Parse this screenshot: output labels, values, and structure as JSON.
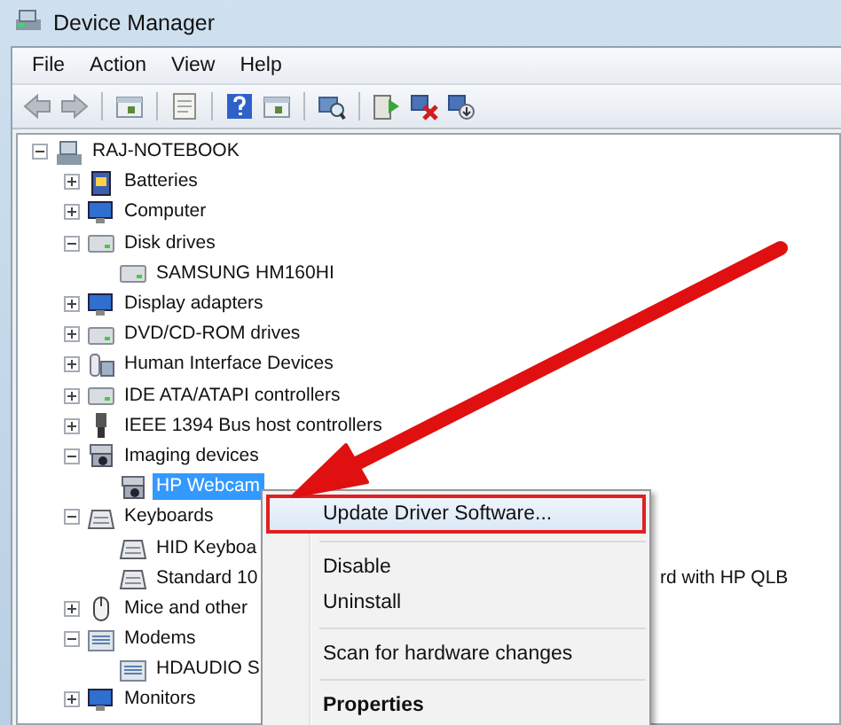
{
  "window": {
    "title": "Device Manager"
  },
  "menu": [
    "File",
    "Action",
    "View",
    "Help"
  ],
  "toolbar": [
    {
      "kind": "back"
    },
    {
      "kind": "forward"
    },
    {
      "kind": "sep"
    },
    {
      "kind": "pane"
    },
    {
      "kind": "sep"
    },
    {
      "kind": "sheet"
    },
    {
      "kind": "sep"
    },
    {
      "kind": "help"
    },
    {
      "kind": "pane"
    },
    {
      "kind": "sep"
    },
    {
      "kind": "scan"
    },
    {
      "kind": "sep"
    },
    {
      "kind": "update"
    },
    {
      "kind": "remove"
    },
    {
      "kind": "enable"
    }
  ],
  "tree": [
    {
      "label": "RAJ-NOTEBOOK",
      "kind": "computer",
      "expanded": true,
      "selected": false,
      "children": [
        {
          "label": "Batteries",
          "kind": "battery",
          "expanded": false,
          "selected": false
        },
        {
          "label": "Computer",
          "kind": "monitor",
          "expanded": false,
          "selected": false
        },
        {
          "label": "Disk drives",
          "kind": "drive",
          "expanded": true,
          "selected": false,
          "children": [
            {
              "label": "SAMSUNG HM160HI",
              "kind": "drive",
              "selected": false
            }
          ]
        },
        {
          "label": "Display adapters",
          "kind": "monitor",
          "expanded": false,
          "selected": false
        },
        {
          "label": "DVD/CD-ROM drives",
          "kind": "drive",
          "expanded": false,
          "selected": false
        },
        {
          "label": "Human Interface Devices",
          "kind": "hid",
          "expanded": false,
          "selected": false
        },
        {
          "label": "IDE ATA/ATAPI controllers",
          "kind": "drive",
          "expanded": false,
          "selected": false
        },
        {
          "label": "IEEE 1394 Bus host controllers",
          "kind": "plug",
          "expanded": false,
          "selected": false
        },
        {
          "label": "Imaging devices",
          "kind": "camera",
          "expanded": true,
          "selected": false,
          "children": [
            {
              "label": "HP Webcam",
              "kind": "camera",
              "selected": true
            }
          ]
        },
        {
          "label": "Keyboards",
          "kind": "keyboard",
          "expanded": true,
          "selected": false,
          "children": [
            {
              "label": "HID Keyboa",
              "kind": "keyboard",
              "selected": false
            },
            {
              "label": "Standard 10",
              "tail": "rd with HP QLB",
              "kind": "keyboard",
              "selected": false
            }
          ]
        },
        {
          "label": "Mice and other",
          "kind": "mouse",
          "expanded": false,
          "selected": false
        },
        {
          "label": "Modems",
          "kind": "modem",
          "expanded": true,
          "selected": false,
          "children": [
            {
              "label": "HDAUDIO S",
              "kind": "modem",
              "selected": false
            }
          ]
        },
        {
          "label": "Monitors",
          "kind": "monitor",
          "expanded": false,
          "selected": false
        }
      ]
    }
  ],
  "context_menu": [
    {
      "label": "Update Driver Software...",
      "highlighted": true,
      "bold": false
    },
    {
      "kind": "sep"
    },
    {
      "label": "Disable",
      "highlighted": false,
      "bold": false
    },
    {
      "label": "Uninstall",
      "highlighted": false,
      "bold": false
    },
    {
      "kind": "sep"
    },
    {
      "label": "Scan for hardware changes",
      "highlighted": false,
      "bold": false
    },
    {
      "kind": "sep"
    },
    {
      "label": "Properties",
      "highlighted": false,
      "bold": true
    }
  ]
}
